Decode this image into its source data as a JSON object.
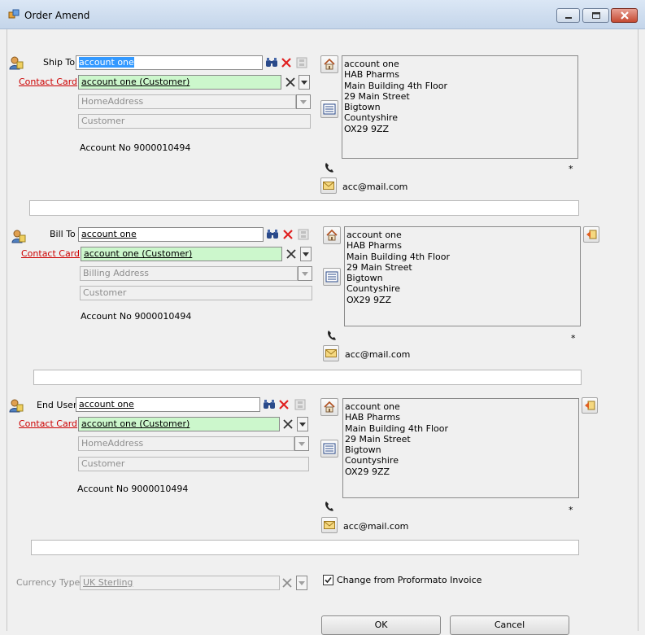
{
  "window": {
    "title": "Order Amend"
  },
  "sections": [
    {
      "label": "Ship To",
      "account": "account one",
      "contact_label": "Contact Card",
      "contact": "account one (Customer)",
      "address_type": "HomeAddress",
      "customer": "Customer",
      "account_no": "Account No 9000010494",
      "address_lines": [
        "account one",
        "HAB Pharms",
        "Main Building 4th Floor",
        "29 Main Street",
        "Bigtown",
        "Countyshire",
        "OX29 9ZZ"
      ],
      "star": "*",
      "email": "acc@mail.com"
    },
    {
      "label": "Bill To",
      "account": "account one",
      "contact_label": "Contact Card",
      "contact": "account one (Customer)",
      "address_type": "Billing Address",
      "customer": "Customer",
      "account_no": "Account No 9000010494",
      "address_lines": [
        "account one",
        "HAB Pharms",
        "Main Building 4th Floor",
        "29 Main Street",
        "Bigtown",
        "Countyshire",
        "OX29 9ZZ"
      ],
      "star": "*",
      "email": "acc@mail.com"
    },
    {
      "label": "End User",
      "account": "account one",
      "contact_label": "Contact Card",
      "contact": "account one (Customer)",
      "address_type": "HomeAddress",
      "customer": "Customer",
      "account_no": "Account No 9000010494",
      "address_lines": [
        "account one",
        "HAB Pharms",
        "Main Building 4th Floor",
        "29 Main Street",
        "Bigtown",
        "Countyshire",
        "OX29 9ZZ"
      ],
      "star": "*",
      "email": "acc@mail.com"
    }
  ],
  "currency": {
    "label": "Currency Type",
    "value": "UK Sterling"
  },
  "proforma": {
    "label": "Change from Proformato Invoice",
    "checked": true
  },
  "buttons": {
    "ok": "OK",
    "cancel": "Cancel"
  }
}
